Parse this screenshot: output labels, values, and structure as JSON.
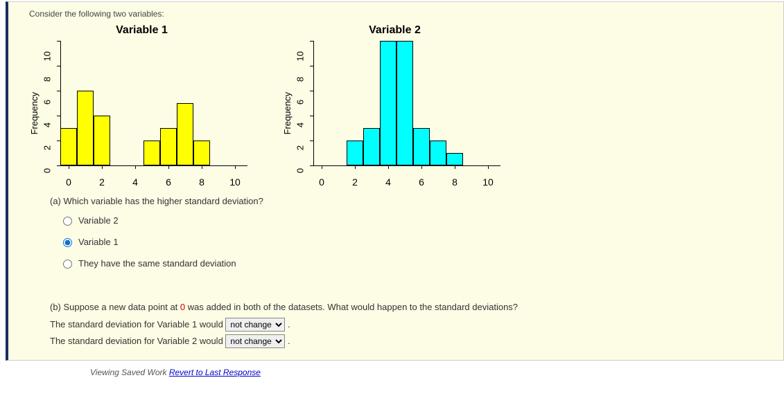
{
  "prompt": "Consider the following two variables:",
  "charts": {
    "ylabel": "Frequency",
    "yticks": [
      "10",
      "8",
      "6",
      "4",
      "2",
      "0"
    ],
    "xlabels": [
      "0",
      "2",
      "4",
      "6",
      "8",
      "10"
    ]
  },
  "chart_data": [
    {
      "type": "bar",
      "title": "Variable 1",
      "xlabel": "",
      "ylabel": "Frequency",
      "ylim": [
        0,
        10
      ],
      "categories": [
        0,
        1,
        2,
        3,
        4,
        5,
        6,
        7,
        8,
        9,
        10
      ],
      "values": [
        3,
        6,
        4,
        0,
        0,
        2,
        3,
        5,
        2,
        0,
        0
      ],
      "bar_color": "#ffff00"
    },
    {
      "type": "bar",
      "title": "Variable 2",
      "xlabel": "",
      "ylabel": "Frequency",
      "ylim": [
        0,
        10
      ],
      "categories": [
        0,
        1,
        2,
        3,
        4,
        5,
        6,
        7,
        8,
        9,
        10
      ],
      "values": [
        0,
        0,
        2,
        3,
        10,
        10,
        3,
        2,
        1,
        0,
        0
      ],
      "bar_color": "#00ffff"
    }
  ],
  "part_a": {
    "label": "(a) Which variable has the higher standard deviation?",
    "options": [
      {
        "text": "Variable 2",
        "selected": false
      },
      {
        "text": "Variable 1",
        "selected": true
      },
      {
        "text": "They have the same standard deviation",
        "selected": false
      }
    ]
  },
  "part_b": {
    "intro_pre": "(b) Suppose a new data point at ",
    "intro_hl": "0",
    "intro_post": " was added in both of the datasets. What would happen to the standard deviations?",
    "line1_pre": "The standard deviation for Variable 1 would ",
    "line2_pre": "The standard deviation for Variable 2 would ",
    "select_value": "not change",
    "period": " ."
  },
  "footer": {
    "viewing": "Viewing Saved Work ",
    "revert": "Revert to Last Response"
  }
}
